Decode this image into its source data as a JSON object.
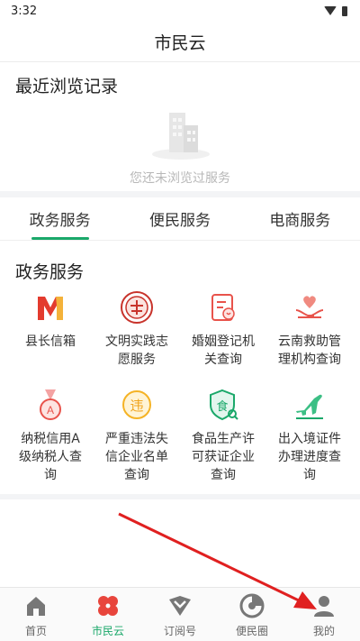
{
  "status_bar": {
    "time": "3:32"
  },
  "header": {
    "title": "市民云"
  },
  "recent": {
    "title": "最近浏览记录",
    "empty_text": "您还未浏览过服务"
  },
  "tabs": [
    {
      "label": "政务服务",
      "active": true
    },
    {
      "label": "便民服务",
      "active": false
    },
    {
      "label": "电商服务",
      "active": false
    }
  ],
  "gov_section": {
    "title": "政务服务",
    "items": [
      {
        "label": "县长信箱",
        "icon": "county-mailbox-icon"
      },
      {
        "label": "文明实践志愿服务",
        "icon": "volunteer-badge-icon"
      },
      {
        "label": "婚姻登记机关查询",
        "icon": "marriage-registry-icon"
      },
      {
        "label": "云南救助管理机构查询",
        "icon": "rescue-hands-icon"
      },
      {
        "label": "纳税信用A级纳税人查询",
        "icon": "tax-medal-icon"
      },
      {
        "label": "严重违法失信企业名单查询",
        "icon": "violation-icon"
      },
      {
        "label": "食品生产许可获证企业查询",
        "icon": "food-license-icon"
      },
      {
        "label": "出入境证件办理进度查询",
        "icon": "airplane-icon"
      }
    ]
  },
  "tabbar": [
    {
      "label": "首页",
      "icon": "home-icon",
      "active": false
    },
    {
      "label": "市民云",
      "icon": "clover-icon",
      "active": true
    },
    {
      "label": "订阅号",
      "icon": "subscription-icon",
      "active": false
    },
    {
      "label": "便民圈",
      "icon": "circle-icon",
      "active": false
    },
    {
      "label": "我的",
      "icon": "profile-icon",
      "active": false
    }
  ],
  "colors": {
    "accent": "#1aa86a",
    "clover": "#e8453c",
    "annotation_arrow": "#e02020"
  }
}
